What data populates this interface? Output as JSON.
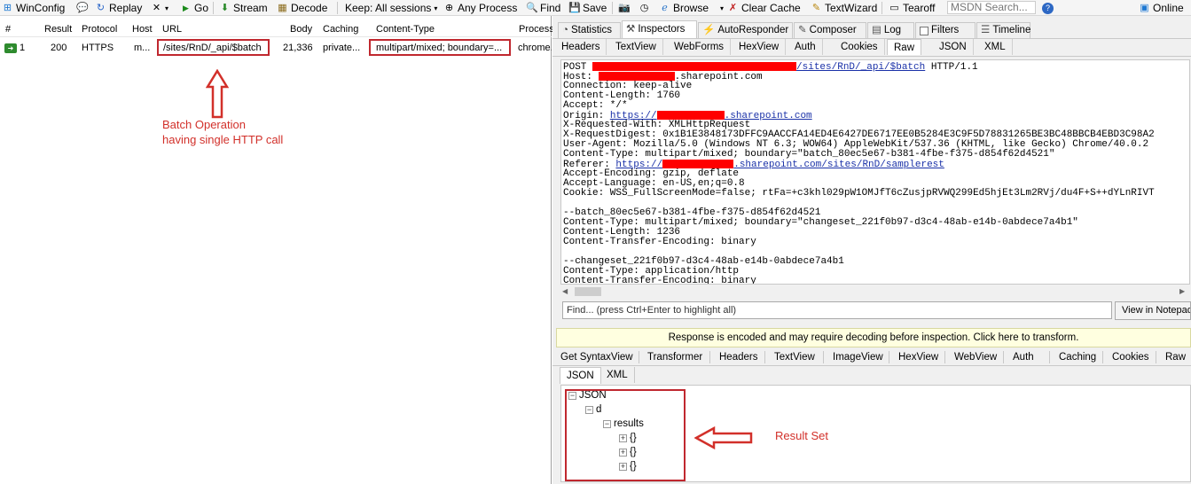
{
  "toolbar": {
    "winconfig": "WinConfig",
    "replay": "Replay",
    "go": "Go",
    "stream": "Stream",
    "decode": "Decode",
    "keep": "Keep: All sessions",
    "any_process": "Any Process",
    "find": "Find",
    "save": "Save",
    "browse": "Browse",
    "clear_cache": "Clear Cache",
    "textwizard": "TextWizard",
    "tearoff": "Tearoff",
    "msdn_search": "MSDN Search...",
    "online": "Online"
  },
  "sessions": {
    "columns": [
      "#",
      "Result",
      "Protocol",
      "Host",
      "URL",
      "Body",
      "Caching",
      "Content-Type",
      "Process"
    ],
    "rows": [
      {
        "num": "1",
        "result": "200",
        "protocol": "HTTPS",
        "host": "m...",
        "url": "/sites/RnD/_api/$batch",
        "body": "21,336",
        "caching": "private...",
        "content_type": "multipart/mixed; boundary=...",
        "process": "chrome..."
      }
    ]
  },
  "annotations": {
    "batch_line1": "Batch Operation",
    "batch_line2": "having single HTTP call",
    "result_set": "Result Set"
  },
  "inspector": {
    "top_tabs": [
      "Statistics",
      "Inspectors",
      "AutoResponder",
      "Composer",
      "Log",
      "Filters",
      "Timeline"
    ],
    "request_tabs": [
      "Headers",
      "TextView",
      "WebForms",
      "HexView",
      "Auth",
      "Cookies",
      "Raw",
      "JSON",
      "XML"
    ],
    "raw": {
      "post": "POST",
      "post_url": "/sites/RnD/_api/$batch",
      "post_ver": " HTTP/1.1",
      "host_label": "Host: ",
      "host_domain": ".sharepoint.com",
      "connection": "Connection: keep-alive",
      "content_length": "Content-Length: 1760",
      "accept": "Accept: */*",
      "origin_label": "Origin: ",
      "origin_prefix": "https://",
      "origin_suffix": ".sharepoint.com",
      "requested_with": "X-Requested-With: XMLHttpRequest",
      "digest": "X-RequestDigest: 0x1B1E3848173DFFC9AACCFA14ED4E6427DE6717EE0B5284E3C9F5D78831265BE3BC48BBCB4EBD3C98A2",
      "user_agent": "User-Agent: Mozilla/5.0 (Windows NT 6.3; WOW64) AppleWebKit/537.36 (KHTML, like Gecko) Chrome/40.0.2",
      "content_type": "Content-Type: multipart/mixed; boundary=\"batch_80ec5e67-b381-4fbe-f375-d854f62d4521\"",
      "referer_label": "Referer: ",
      "referer_prefix": "https://",
      "referer_suffix": ".sharepoint.com/sites/RnD/samplerest",
      "accept_encoding": "Accept-Encoding: gzip, deflate",
      "accept_language": "Accept-Language: en-US,en;q=0.8",
      "cookie": "Cookie: WSS_FullScreenMode=false; rtFa=+c3khl029pW1OMJfT6cZusjpRVWQ299Ed5hjEt3Lm2RVj/du4F+S++dYLnRIVT",
      "batch_boundary": "--batch_80ec5e67-b381-4fbe-f375-d854f62d4521",
      "batch_ct": "Content-Type: multipart/mixed; boundary=\"changeset_221f0b97-d3c4-48ab-e14b-0abdece7a4b1\"",
      "batch_cl": "Content-Length: 1236",
      "batch_cte": "Content-Transfer-Encoding: binary",
      "changeset_boundary": "--changeset_221f0b97-d3c4-48ab-e14b-0abdece7a4b1",
      "cs_ct": "Content-Type: application/http",
      "cs_cte": "Content-Transfer-Encoding: binary"
    },
    "find_placeholder": "Find... (press Ctrl+Enter to highlight all)",
    "view_notepad": "View in Notepad",
    "banner": "Response is encoded and may require decoding before inspection. Click here to transform.",
    "response_tabs": [
      "Get SyntaxView",
      "Transformer",
      "Headers",
      "TextView",
      "ImageView",
      "HexView",
      "WebView",
      "Auth",
      "Caching",
      "Cookies",
      "Raw"
    ],
    "response_subtabs": [
      "JSON",
      "XML"
    ],
    "tree": {
      "root": "JSON",
      "d": "d",
      "results": "results",
      "item": "{}"
    }
  },
  "colors": {
    "annotation_red": "#c0282f",
    "redaction": "#ff0000",
    "link": "#1a31a8"
  }
}
